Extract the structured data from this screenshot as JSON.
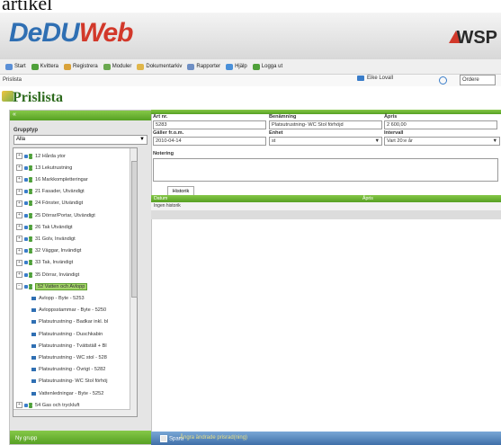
{
  "top_crop_text": "artikel",
  "app": {
    "logo_part1": "DeDU",
    "logo_part2": "Web",
    "brand": "WSP"
  },
  "toolbar": {
    "items": [
      {
        "label": "Start",
        "icon": "home-icon",
        "color": "#5a8fd6"
      },
      {
        "label": "Kvittera",
        "icon": "check-icon",
        "color": "#4fa03a"
      },
      {
        "label": "Registrera",
        "icon": "register-icon",
        "color": "#d9a23a"
      },
      {
        "label": "Moduler",
        "icon": "modules-icon",
        "color": "#6aa84f"
      },
      {
        "label": "Dokumentarkiv",
        "icon": "archive-icon",
        "color": "#e0b64a"
      },
      {
        "label": "Rapporter",
        "icon": "report-icon",
        "color": "#6f8fc4"
      },
      {
        "label": "Hjälp",
        "icon": "help-icon",
        "color": "#4a90d9"
      },
      {
        "label": "Logga ut",
        "icon": "logout-icon",
        "color": "#4fa03a"
      }
    ],
    "breadcrumb": "Prislista",
    "user_name": "Eike Lovall",
    "order_select": "Ordere"
  },
  "page_title": "Prislista",
  "left": {
    "grupptyp_label": "Grupptyp",
    "grupptyp_value": "Alla",
    "tree": [
      {
        "label": "12 Hårda ytor",
        "type": "node",
        "indent": 0
      },
      {
        "label": "13 Lekutrustning",
        "type": "node",
        "indent": 0
      },
      {
        "label": "16 Markkompletteringar",
        "type": "node",
        "indent": 0
      },
      {
        "label": "21 Fasader, Utvändigt",
        "type": "node",
        "indent": 0
      },
      {
        "label": "24 Fönster, Utvändigt",
        "type": "node",
        "indent": 0
      },
      {
        "label": "25 Dörrar/Portar, Utvändigt",
        "type": "node",
        "indent": 0
      },
      {
        "label": "26 Tak Utvändigt",
        "type": "node",
        "indent": 0
      },
      {
        "label": "31 Golv, Invändigt",
        "type": "node",
        "indent": 0
      },
      {
        "label": "32 Väggar, Invändigt",
        "type": "node",
        "indent": 0
      },
      {
        "label": "33 Tak, Invändigt",
        "type": "node",
        "indent": 0
      },
      {
        "label": "35 Dörrar, Invändigt",
        "type": "node",
        "indent": 0
      },
      {
        "label": "52 Vatten och Avlopp",
        "type": "node",
        "indent": 0,
        "selected": true
      },
      {
        "label": "Avlopp - Byte - 5253",
        "type": "leaf",
        "indent": 1
      },
      {
        "label": "Avloppsstammar - Byte - 5250",
        "type": "leaf",
        "indent": 1
      },
      {
        "label": "Platsutrustning - Badkar inkl. bl",
        "type": "leaf",
        "indent": 1
      },
      {
        "label": "Platsutrustning - Duschkabin",
        "type": "leaf",
        "indent": 1
      },
      {
        "label": "Platsutrustning - Tvättställ + Bl",
        "type": "leaf",
        "indent": 1
      },
      {
        "label": "Platsutrustning - WC stol - 528",
        "type": "leaf",
        "indent": 1
      },
      {
        "label": "Platsutrustning - Övrigt - 5282",
        "type": "leaf",
        "indent": 1
      },
      {
        "label": "Platsutrustning- WC Stol förhöj",
        "type": "leaf",
        "indent": 1
      },
      {
        "label": "Vattenledningar - Byte - 5252",
        "type": "leaf",
        "indent": 1
      },
      {
        "label": "54 Gas och tryckluft",
        "type": "node",
        "indent": 0
      }
    ],
    "new_group": "Ny grupp"
  },
  "form": {
    "art_label": "Art nr.",
    "art_value": "5283",
    "ben_label": "Benämning",
    "ben_value": "Platsutrustning- WC Stol förhöjd",
    "apris_label": "Åpris",
    "apris_value": "2 600,00",
    "galler_label": "Gäller fr.o.m.",
    "galler_value": "2010-04-14",
    "enhet_label": "Enhet",
    "enhet_value": "st",
    "intervall_label": "Intervall",
    "intervall_value": "Vart 20:e år",
    "notering_label": "Notering",
    "notering_value": ""
  },
  "history": {
    "tab": "Historik",
    "col_datum": "Datum",
    "col_apris": "Åpris",
    "empty": "Ingen historik"
  },
  "bottom": {
    "save": "Spara",
    "faint": "Ångra ändrade prisrad(ning)"
  }
}
